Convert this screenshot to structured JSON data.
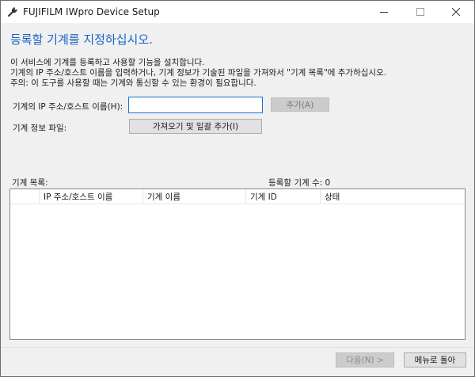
{
  "window": {
    "title": "FUJIFILM IWpro Device Setup"
  },
  "page": {
    "heading": "등록할 기계를 지정하십시오.",
    "description": [
      "이 서비스에 기계를 등록하고 사용할 기능을 설치합니다.",
      "기계의 IP 주소/호스트 이름을 입력하거나, 기계 정보가 기술된 파일을 가져와서 \"기계 목록\"에 추가하십시오.",
      "주의: 이 도구를 사용할 때는 기계와 통신할 수 있는 환경이 필요합니다."
    ]
  },
  "form": {
    "host_label": "기계의 IP 주소/호스트 이름(H):",
    "host_value": "",
    "add_button": "추가(A)",
    "add_enabled": false,
    "file_label": "기계 정보 파일:",
    "import_button": "가져오기 및 일괄 추가(I)"
  },
  "device_list": {
    "label": "기계 목록:",
    "count_label": "등록할 기계 수: 0",
    "columns": [
      "",
      "IP 주소/호스트 이름",
      "기계 이름",
      "기계 ID",
      "상태"
    ],
    "rows": []
  },
  "footer": {
    "next_button": "다음(N) >",
    "next_enabled": false,
    "back_button": "메뉴로 돌아"
  },
  "colors": {
    "heading": "#1464c8",
    "input_border": "#1a72d2"
  }
}
